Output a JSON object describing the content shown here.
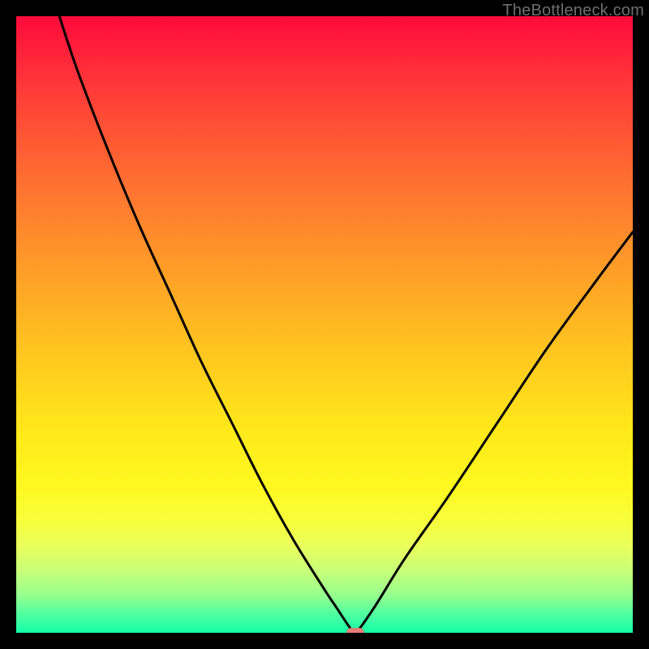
{
  "watermark": "TheBottleneck.com",
  "colors": {
    "frame_bg": "#000000",
    "marker": "#e77f7a",
    "curve": "#000000"
  },
  "chart_data": {
    "type": "line",
    "title": "",
    "xlabel": "",
    "ylabel": "",
    "xlim": [
      0,
      100
    ],
    "ylim": [
      0,
      100
    ],
    "grid": false,
    "legend": false,
    "series": [
      {
        "name": "bottleneck-curve",
        "x": [
          7,
          10,
          15,
          20,
          25,
          30,
          35,
          40,
          45,
          50,
          52,
          54,
          55,
          58,
          63,
          70,
          78,
          86,
          94,
          100
        ],
        "y": [
          100,
          91,
          78,
          66,
          55,
          44,
          34,
          24,
          15,
          7,
          4,
          1,
          0,
          4,
          12,
          22,
          34,
          46,
          57,
          65
        ]
      }
    ],
    "marker": {
      "x": 55,
      "y": 0,
      "shape": "rounded-rect",
      "color": "#e77f7a"
    },
    "gradient_stops": [
      {
        "pos": 0,
        "color": "#ff0a3a"
      },
      {
        "pos": 8,
        "color": "#ff2b3a"
      },
      {
        "pos": 18,
        "color": "#ff5135"
      },
      {
        "pos": 30,
        "color": "#ff7a30"
      },
      {
        "pos": 42,
        "color": "#ffa027"
      },
      {
        "pos": 55,
        "color": "#ffc71f"
      },
      {
        "pos": 67,
        "color": "#ffe81a"
      },
      {
        "pos": 76,
        "color": "#fff81f"
      },
      {
        "pos": 82,
        "color": "#f7ff3c"
      },
      {
        "pos": 86,
        "color": "#e9ff5c"
      },
      {
        "pos": 90,
        "color": "#c7ff78"
      },
      {
        "pos": 94,
        "color": "#95ff8e"
      },
      {
        "pos": 97,
        "color": "#4fffa0"
      },
      {
        "pos": 100,
        "color": "#13ffa7"
      }
    ]
  }
}
